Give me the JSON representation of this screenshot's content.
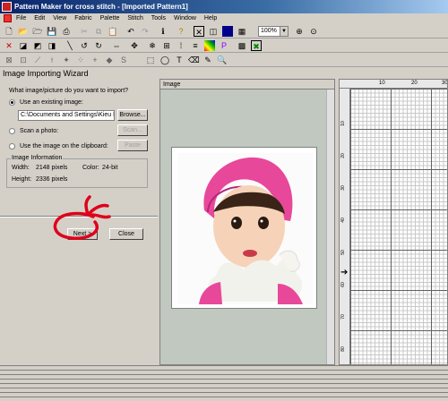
{
  "window": {
    "title": "Pattern Maker for cross stitch - [Imported Pattern1]"
  },
  "menu": [
    "File",
    "Edit",
    "View",
    "Fabric",
    "Palette",
    "Stitch",
    "Tools",
    "Window",
    "Help"
  ],
  "toolbar": {
    "zoom_value": "100%"
  },
  "wizard": {
    "title": "Image Importing Wizard",
    "question": "What image/picture do you want to import?",
    "opt_existing": "Use an existing image:",
    "path_value": "C:\\Documents and Settings\\Kieu Ph",
    "browse_label": "Browse...",
    "opt_scan": "Scan a photo:",
    "scan_label": "Scan...",
    "opt_clipboard": "Use the image on the clipboard:",
    "paste_label": "Paste",
    "info": {
      "group_title": "Image Information",
      "width_label": "Width:",
      "width_value": "2148 pixels",
      "color_label": "Color:",
      "color_value": "24-bit",
      "height_label": "Height:",
      "height_value": "2336 pixels"
    },
    "next_label": "Next >",
    "close_label": "Close"
  },
  "image_panel": {
    "title": "Image"
  },
  "grid": {
    "top_ticks": [
      "10",
      "20",
      "30"
    ],
    "left_ticks": [
      "10",
      "20",
      "30",
      "40",
      "50",
      "60",
      "70",
      "80"
    ]
  },
  "colors": {
    "annotation": "#e0001a",
    "titlebar": "#0a246a",
    "hat": "#e8489a"
  }
}
